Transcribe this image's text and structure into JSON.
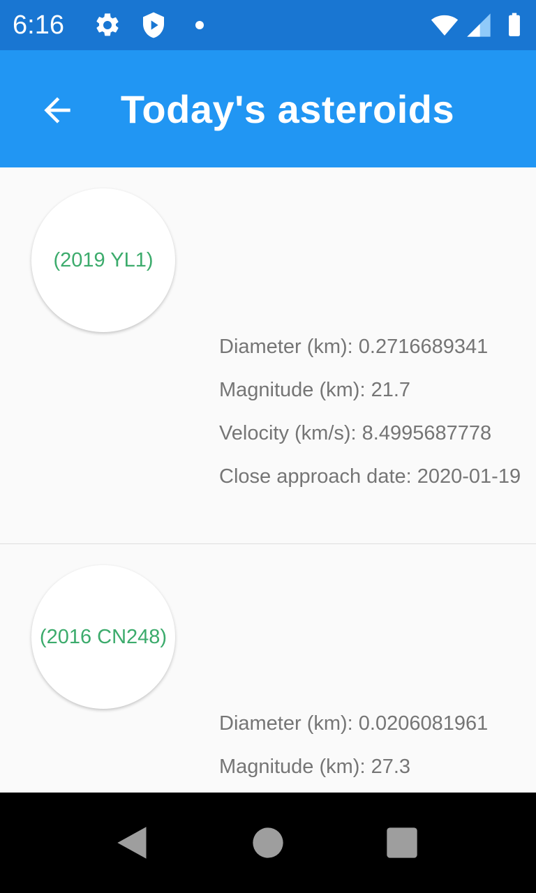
{
  "status_bar": {
    "time": "6:16",
    "icons": [
      "settings-icon",
      "shield-play-icon",
      "notification-dot-icon",
      "wifi-icon",
      "signal-icon",
      "battery-icon"
    ]
  },
  "app_bar": {
    "title": "Today's asteroids",
    "back_icon": "arrow-back-icon"
  },
  "asteroids": [
    {
      "name": "(2019 YL1)",
      "diameter_label": "Diameter (km): ",
      "diameter": "0.2716689341",
      "magnitude_label": "Magnitude (km): ",
      "magnitude": "21.7",
      "velocity_label": "Velocity (km/s): ",
      "velocity": "8.4995687778",
      "date_label": "Close approach date: ",
      "date": "2020-01-19"
    },
    {
      "name": "(2016 CN248)",
      "diameter_label": "Diameter (km): ",
      "diameter": "0.0206081961",
      "magnitude_label": "Magnitude (km): ",
      "magnitude": "27.3"
    }
  ],
  "nav_bar": {
    "icons": [
      "back-triangle-icon",
      "home-circle-icon",
      "recents-square-icon"
    ]
  },
  "colors": {
    "status_bar": "#1976d2",
    "app_bar": "#2196f3",
    "asteroid_name": "#3cab6c",
    "detail_text": "#757575",
    "background": "#fafafa"
  }
}
